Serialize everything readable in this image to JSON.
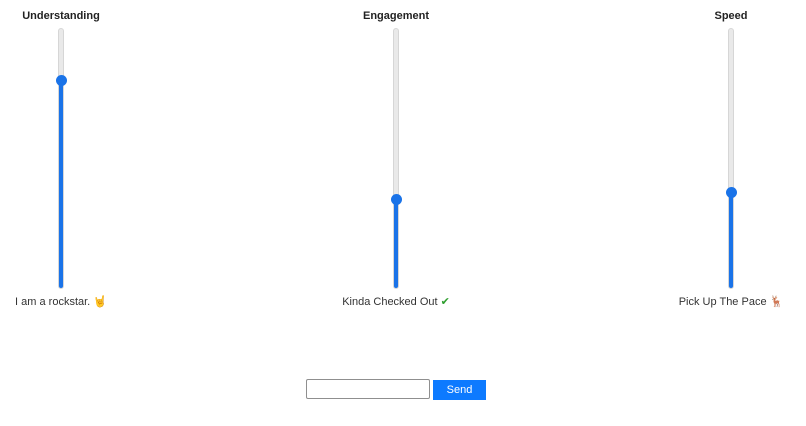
{
  "sliders": [
    {
      "title": "Understanding",
      "value": 0.8,
      "caption": "I am a rockstar.",
      "emoji": "🤘",
      "emoji_name": "rock-on-hand-icon"
    },
    {
      "title": "Engagement",
      "value": 0.34,
      "caption": "Kinda Checked Out",
      "emoji": "✔",
      "emoji_name": "checkmark-icon"
    },
    {
      "title": "Speed",
      "value": 0.37,
      "caption": "Pick Up The Pace",
      "emoji": "🦌",
      "emoji_name": "deer-icon"
    }
  ],
  "form": {
    "input_value": "",
    "send_label": "Send"
  },
  "colors": {
    "accent": "#1a73e8",
    "button": "#0d7aff",
    "track": "#e9e9e9"
  }
}
